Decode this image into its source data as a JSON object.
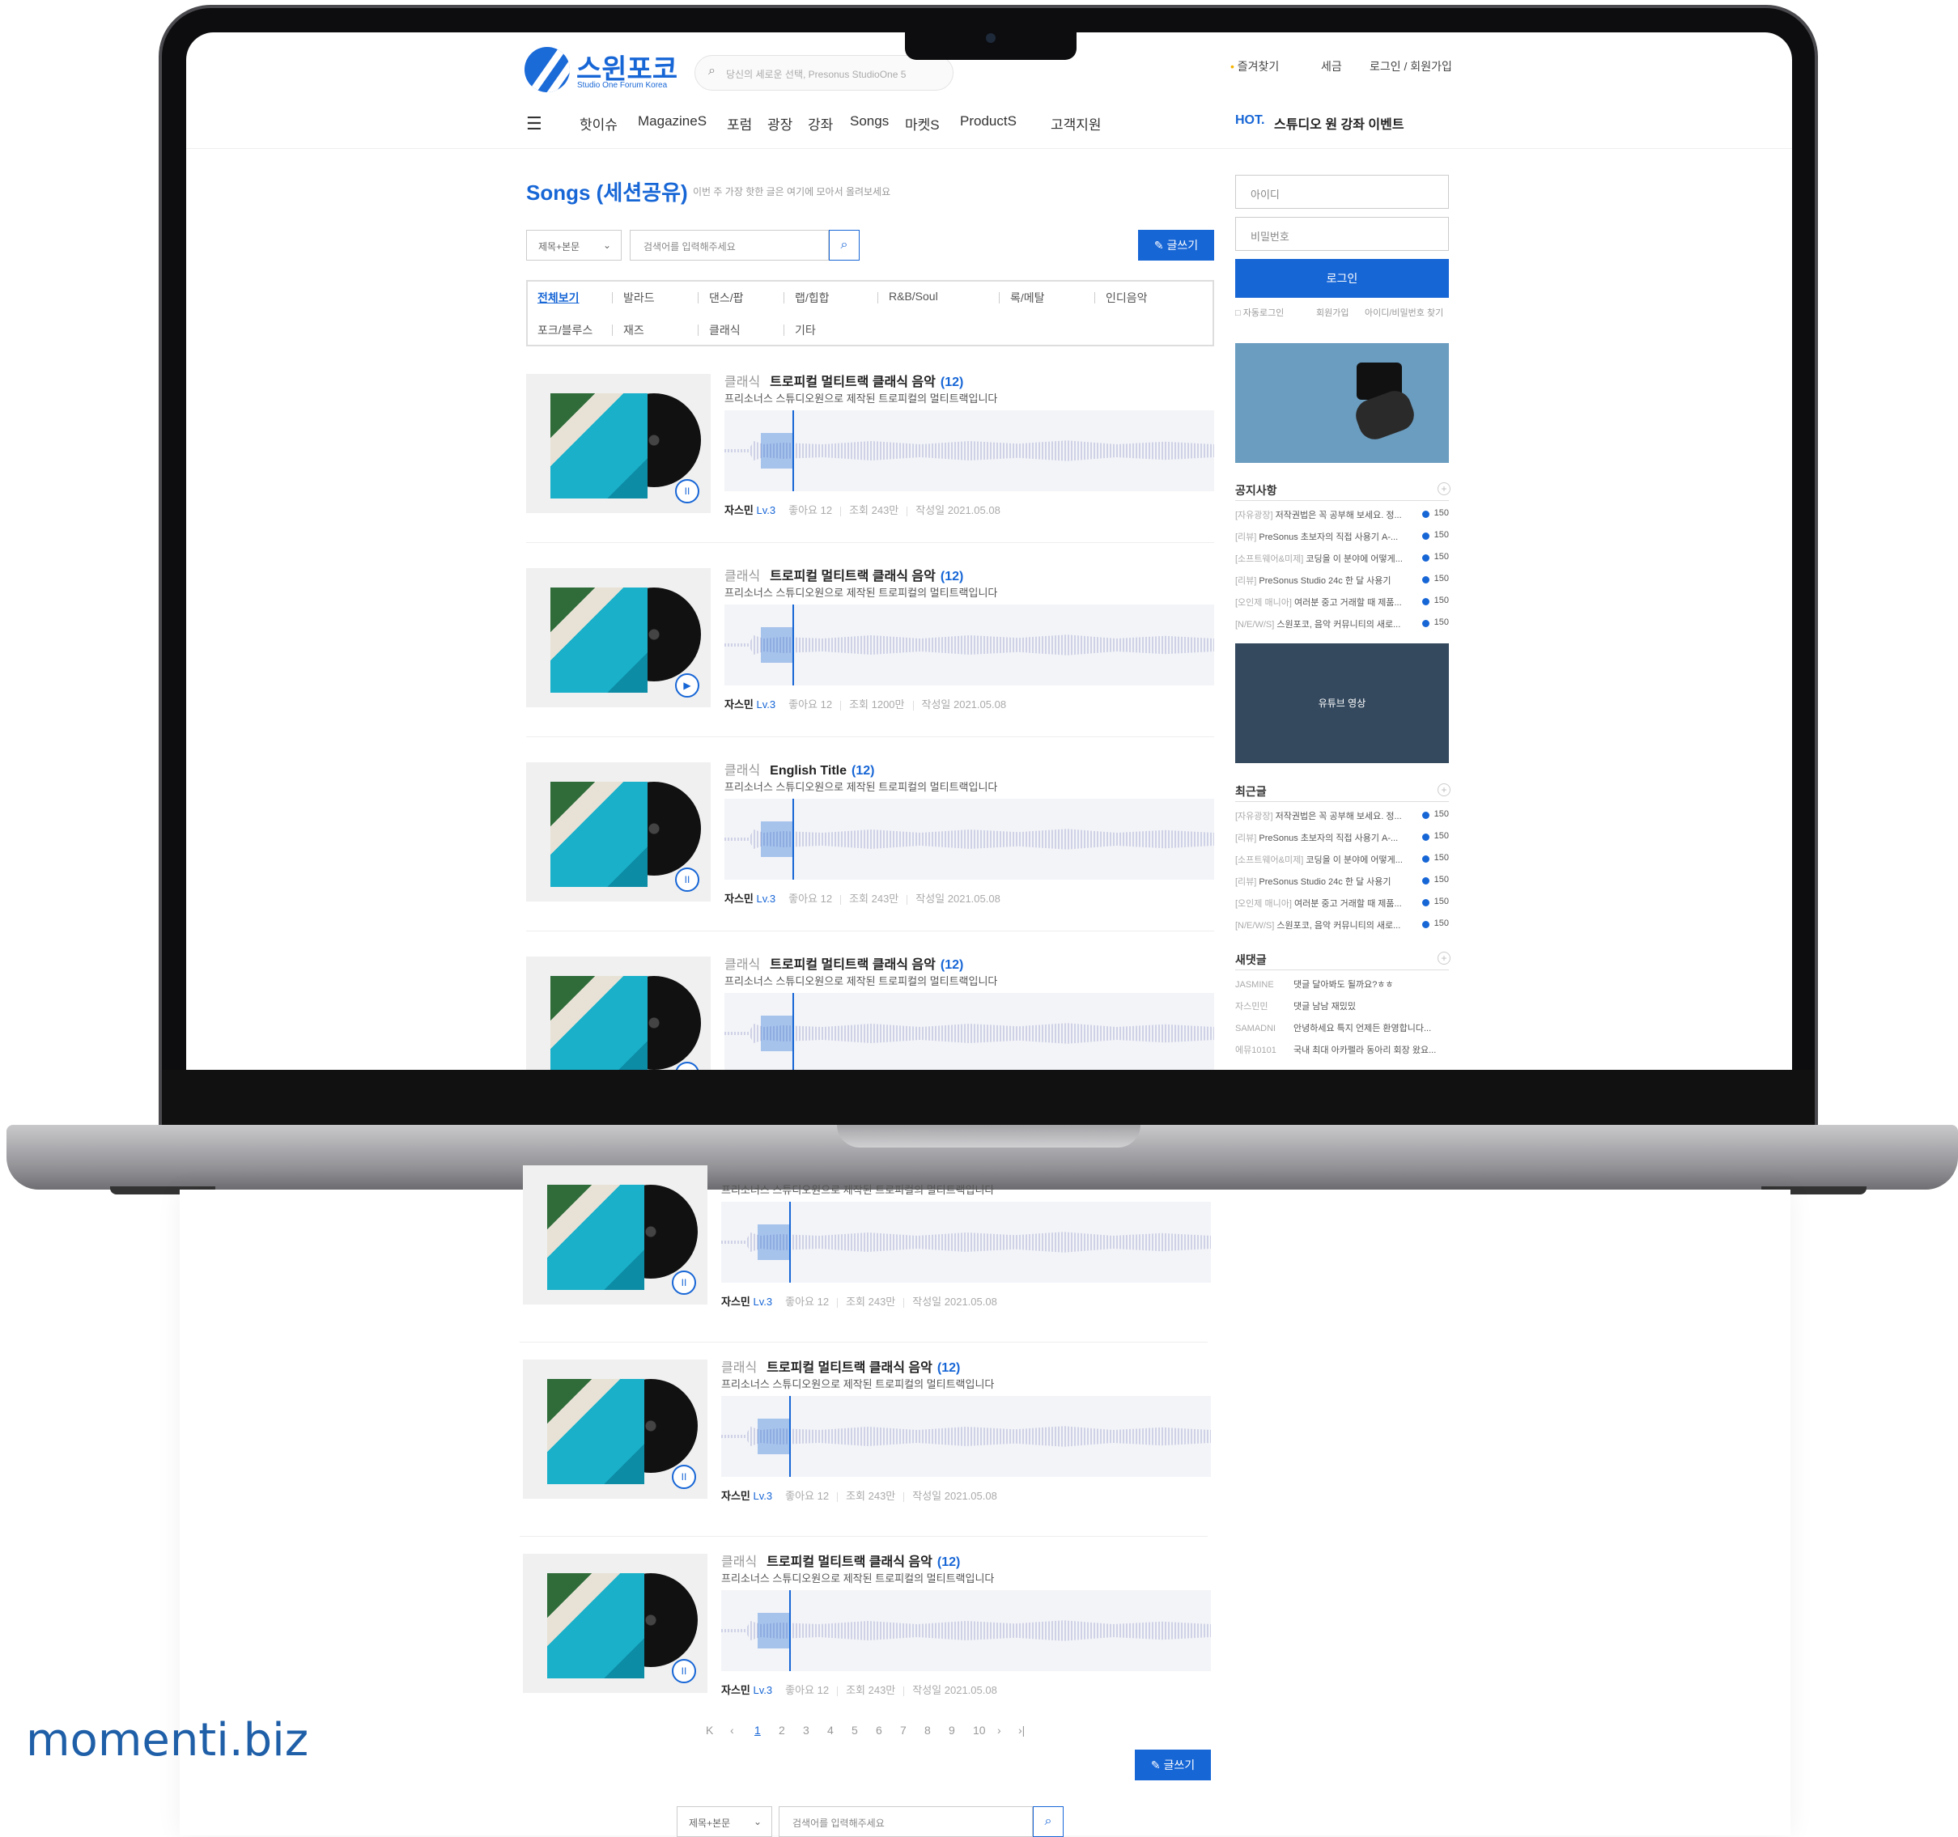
{
  "header": {
    "logo_text": "스윈포코",
    "logo_sub": "Studio One Forum Korea",
    "search_placeholder": "당신의 세로운 선택, Presonus StudioOne 5",
    "util": [
      "즐겨찾기",
      "세금",
      "로그인 / 회원가입"
    ],
    "nav": [
      "핫이슈",
      "MagazineS",
      "포럼",
      "광장",
      "강좌",
      "Songs",
      "마켓S",
      "ProductS",
      "고객지원"
    ],
    "hot_label": "HOT.",
    "hot_text": "스튜디오 원 강좌 이벤트"
  },
  "board": {
    "title": "Songs (세션공유)",
    "subtitle": "이번 주 가장 핫한 글은 여기에 모아서 올려보세요",
    "filter_select": "제목+본문",
    "search_placeholder": "검색어를 입력해주세요",
    "write_button": "글쓰기",
    "categories": [
      "전체보기",
      "발라드",
      "댄스/팝",
      "랩/힙합",
      "R&B/Soul",
      "록/메탈",
      "인디음악",
      "포크/블루스",
      "재즈",
      "클래식",
      "기타"
    ]
  },
  "songs": [
    {
      "genre": "클래식",
      "title": "트로피컬 멀티트랙 클래식 음악",
      "count": "(12)",
      "desc": "프리소너스 스튜디오원으로 제작된 트로피컬의 멀티트랙입니다",
      "author": "자스민",
      "level": "Lv.3",
      "likes": "좋아요 12",
      "views": "조회 243만",
      "date": "작성일 2021.05.08",
      "state": "pause"
    },
    {
      "genre": "클래식",
      "title": "트로피컬 멀티트랙 클래식 음악",
      "count": "(12)",
      "desc": "프리소너스 스튜디오원으로 제작된 트로피컬의 멀티트랙입니다",
      "author": "자스민",
      "level": "Lv.3",
      "likes": "좋아요 12",
      "views": "조회 1200만",
      "date": "작성일 2021.05.08",
      "state": "play"
    },
    {
      "genre": "클래식",
      "title": "English Title",
      "count": "(12)",
      "desc": "프리소너스 스튜디오원으로 제작된 트로피컬의 멀티트랙입니다",
      "author": "자스민",
      "level": "Lv.3",
      "likes": "좋아요 12",
      "views": "조회 243만",
      "date": "작성일 2021.05.08",
      "state": "pause"
    },
    {
      "genre": "클래식",
      "title": "트로피컬 멀티트랙 클래식 음악",
      "count": "(12)",
      "desc": "프리소너스 스튜디오원으로 제작된 트로피컬의 멀티트랙입니다",
      "author": "",
      "level": "",
      "likes": "",
      "views": "",
      "date": "",
      "state": "pause"
    }
  ],
  "songs_page2": [
    {
      "genre": "",
      "title": "",
      "count": "",
      "desc": "프리소너스 스튜디오원으로 제작된 트로피컬의 멀티트랙입니다",
      "author": "자스민",
      "level": "Lv.3",
      "likes": "좋아요 12",
      "views": "조회 243만",
      "date": "작성일 2021.05.08",
      "state": "pause"
    },
    {
      "genre": "클래식",
      "title": "트로피컬 멀티트랙 클래식 음악",
      "count": "(12)",
      "desc": "프리소너스 스튜디오원으로 제작된 트로피컬의 멀티트랙입니다",
      "author": "자스민",
      "level": "Lv.3",
      "likes": "좋아요 12",
      "views": "조회 243만",
      "date": "작성일 2021.05.08",
      "state": "pause"
    },
    {
      "genre": "클래식",
      "title": "트로피컬 멀티트랙 클래식 음악",
      "count": "(12)",
      "desc": "프리소너스 스튜디오원으로 제작된 트로피컬의 멀티트랙입니다",
      "author": "자스민",
      "level": "Lv.3",
      "likes": "좋아요 12",
      "views": "조회 243만",
      "date": "작성일 2021.05.08",
      "state": "pause"
    }
  ],
  "sidebar": {
    "id_placeholder": "아이디",
    "pw_placeholder": "비밀번호",
    "login_button": "로그인",
    "auto_login": "자동로그인",
    "join": "회원가입",
    "find": "아이디/비밀번호 찾기",
    "notice_title": "공지사항",
    "notices": [
      {
        "tag": "[자유광장]",
        "text": "저작권법은 꼭 공부해 보세요. 정...",
        "num": "150"
      },
      {
        "tag": "[리뷰]",
        "text": "PreSonus 초보자의 직접 사용기 A-...",
        "num": "150"
      },
      {
        "tag": "[소프트웨어&미제]",
        "text": "코딩을 이 분야에 어떻게...",
        "num": "150"
      },
      {
        "tag": "[리뷰]",
        "text": "PreSonus Studio 24c 한 달 사용기",
        "num": "150"
      },
      {
        "tag": "[오인제 매니아]",
        "text": "여러분 중고 거래할 때 제품...",
        "num": "150"
      },
      {
        "tag": "[N/E/W/S]",
        "text": "스원포코, 음악 커뮤니티의 새로...",
        "num": "150"
      }
    ],
    "video_label": "유튜브 영상",
    "recent_title": "최근글",
    "recent": [
      {
        "tag": "[자유광장]",
        "text": "저작권법은 꼭 공부해 보세요. 정...",
        "num": "150"
      },
      {
        "tag": "[리뷰]",
        "text": "PreSonus 초보자의 직접 사용기 A-...",
        "num": "150"
      },
      {
        "tag": "[소프트웨어&미제]",
        "text": "코딩을 이 분야에 어떻게...",
        "num": "150"
      },
      {
        "tag": "[리뷰]",
        "text": "PreSonus Studio 24c 한 달 사용기",
        "num": "150"
      },
      {
        "tag": "[오인제 매니아]",
        "text": "여러분 중고 거래할 때 제품...",
        "num": "150"
      },
      {
        "tag": "[N/E/W/S]",
        "text": "스원포코, 음악 커뮤니티의 새로...",
        "num": "150"
      }
    ],
    "comments_title": "새댓글",
    "comments": [
      {
        "user": "JASMINE",
        "text": "댓글 달아봐도 될까요?ㅎㅎ"
      },
      {
        "user": "자스민민",
        "text": "댓글 남남 재밌밌"
      },
      {
        "user": "SAMADNI",
        "text": "안녕하세요 특지 언제든 환영합니다..."
      },
      {
        "user": "에뮤10101",
        "text": "국내 최대 아카펠라 동아리 회장 왔요..."
      }
    ]
  },
  "pagination": {
    "first": "K",
    "prev": "‹",
    "pages": [
      "1",
      "2",
      "3",
      "4",
      "5",
      "6",
      "7",
      "8",
      "9",
      "10"
    ],
    "next": "›",
    "last": "›|",
    "current": "1"
  },
  "bottom_search": {
    "select": "제목+본문",
    "placeholder": "검색어를 입력해주세요"
  },
  "watermark": "momenti.biz",
  "colors": {
    "accent": "#1766d6"
  }
}
